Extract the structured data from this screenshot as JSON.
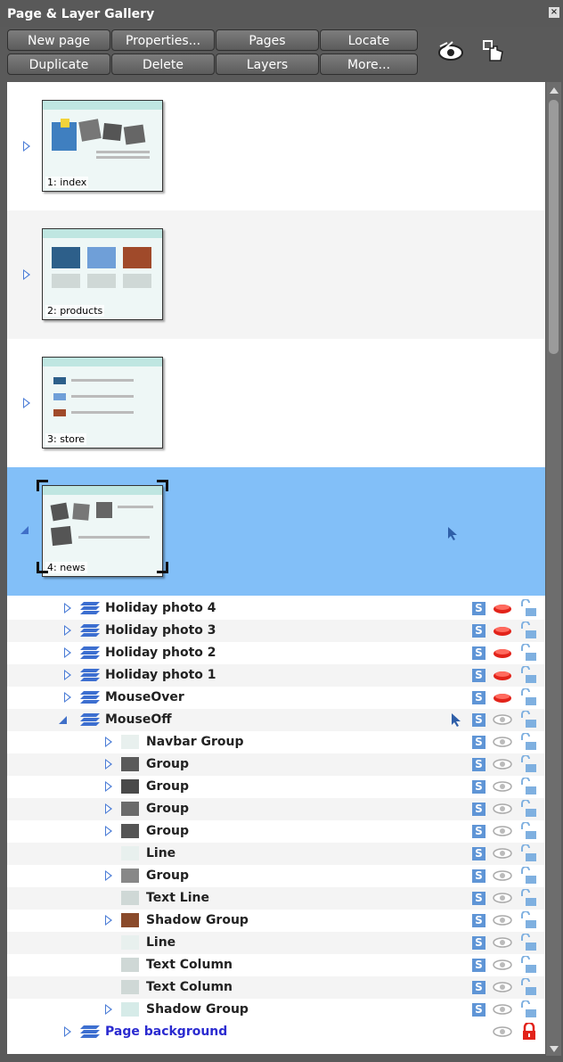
{
  "window": {
    "title": "Page & Layer Gallery",
    "close_label": "×"
  },
  "buttons": {
    "new_page": "New page",
    "properties": "Properties...",
    "pages": "Pages",
    "locate": "Locate",
    "duplicate": "Duplicate",
    "delete": "Delete",
    "layers": "Layers",
    "more": "More..."
  },
  "toolbar_icons": [
    "show-all-layers-icon",
    "hand-lock-icon"
  ],
  "pages": [
    {
      "label": "1: index"
    },
    {
      "label": "2: products"
    },
    {
      "label": "3: store"
    },
    {
      "label": "4: news"
    }
  ],
  "layers": [
    {
      "name": "Holiday photo 4"
    },
    {
      "name": "Holiday photo 3"
    },
    {
      "name": "Holiday photo 2"
    },
    {
      "name": "Holiday photo 1"
    },
    {
      "name": "MouseOver"
    },
    {
      "name": "MouseOff"
    }
  ],
  "objects": [
    {
      "name": "Navbar Group"
    },
    {
      "name": "Group"
    },
    {
      "name": "Group"
    },
    {
      "name": "Group"
    },
    {
      "name": "Group"
    },
    {
      "name": "Line"
    },
    {
      "name": "Group"
    },
    {
      "name": "Text Line"
    },
    {
      "name": "Shadow Group"
    },
    {
      "name": "Line"
    },
    {
      "name": "Text Column"
    },
    {
      "name": "Text Column"
    },
    {
      "name": "Shadow Group"
    }
  ],
  "page_background": {
    "name": "Page background"
  },
  "icons": {
    "s": "S"
  },
  "colors": {
    "selected_row": "#82bff8",
    "accent_blue": "#4a7cd6",
    "red": "#e2231a",
    "link_blue": "#2a2ad0"
  }
}
